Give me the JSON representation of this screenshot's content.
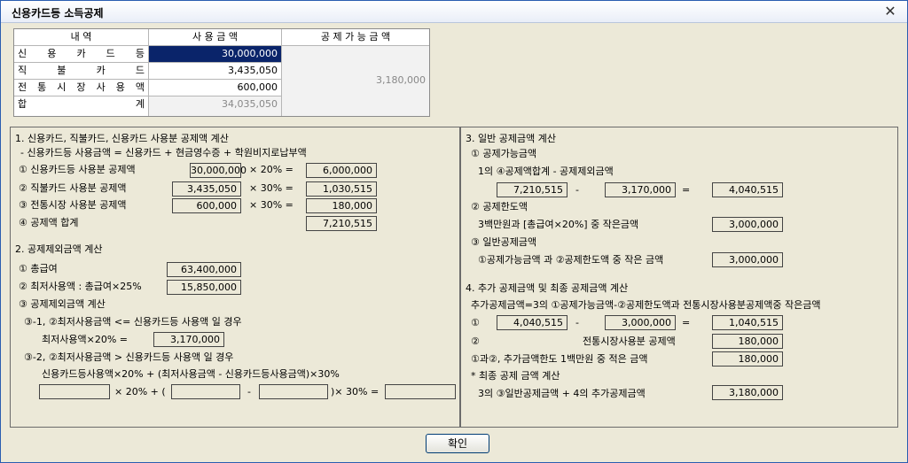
{
  "window": {
    "title": "신용카드등 소득공제"
  },
  "table": {
    "headers": {
      "item": "내 역",
      "amount": "사 용 금 액",
      "deductible": "공 제 가 능 금 액"
    },
    "rows": [
      {
        "label": "신 용 카 드 등",
        "value": "30,000,000"
      },
      {
        "label": "직 불 카 드",
        "value": "3,435,050"
      },
      {
        "label": "전 통 시 장 사 용 액",
        "value": "600,000"
      },
      {
        "label": "합 계",
        "value": "34,035,050"
      }
    ],
    "deductible_value": "3,180,000"
  },
  "left": {
    "s1_title": "1. 신용카드, 직불카드, 신용카드 사용분 공제액 계산",
    "s1_note": "- 신용카드등 사용금액 = 신용카드 + 현금영수증 + 학원비지로납부액",
    "r1_label": "① 신용카드등 사용분 공제액",
    "r1_amount": "30,000,000",
    "r1_rate": "× 20% =",
    "r1_result": "6,000,000",
    "r2_label": "② 직불카드 사용분 공제액",
    "r2_amount": "3,435,050",
    "r2_rate": "× 30% =",
    "r2_result": "1,030,515",
    "r3_label": "③ 전통시장 사용분 공제액",
    "r3_amount": "600,000",
    "r3_rate": "× 30% =",
    "r3_result": "180,000",
    "r4_label": "④ 공제액 합계",
    "r4_result": "7,210,515",
    "s2_title": "2. 공제제외금액 계산",
    "s2_r1_label": "① 총급여",
    "s2_r1_value": "63,400,000",
    "s2_r2_label": "② 최저사용액 : 총급여×25%",
    "s2_r2_value": "15,850,000",
    "s2_r3_label": "③ 공제제외금액 계산",
    "s2_c1": "③-1,  ②최저사용금액 <= 신용카드등 사용액 일 경우",
    "s2_c1_formula": "최저사용액×20% =",
    "s2_c1_value": "3,170,000",
    "s2_c2": "③-2,  ②최저사용금액 > 신용카드등 사용액 일 경우",
    "s2_c2_formula": "신용카드등사용액×20% + (최저사용금액 - 신용카드등사용금액)×30%",
    "s2_c2_t1": "× 20% + (",
    "s2_c2_t2": "-",
    "s2_c2_t3": ")× 30% ="
  },
  "right": {
    "s3_title": "3. 일반 공제금액 계산",
    "s3_a": "① 공제가능금액",
    "s3_a_formula": "1의 ④공제액합계 - 공제제외금액",
    "s3_a_v1": "7,210,515",
    "s3_a_minus": "-",
    "s3_a_v2": "3,170,000",
    "s3_a_eq": "=",
    "s3_a_v3": "4,040,515",
    "s3_b": "② 공제한도액",
    "s3_b_formula": "3백만원과 [총급여×20%] 중 작은금액",
    "s3_b_value": "3,000,000",
    "s3_c": "③ 일반공제금액",
    "s3_c_formula": "①공제가능금액  과 ②공제한도액 중 작은 금액",
    "s3_c_value": "3,000,000",
    "s4_title": "4. 추가 공제금액 및 최종 공제금액 계산",
    "s4_formula": "추가공제금액=3의 ①공제가능금액-②공제한도액과 전통시장사용분공제액중 작은금액",
    "s4_r1_mark": "①",
    "s4_r1_v1": "4,040,515",
    "s4_r1_minus": "-",
    "s4_r1_v2": "3,000,000",
    "s4_r1_eq": "=",
    "s4_r1_v3": "1,040,515",
    "s4_r2_mark": "②",
    "s4_r2_label": "전통시장사용분 공제액",
    "s4_r2_value": "180,000",
    "s4_r3_label": "①과②, 추가금액한도 1백만원 중 적은 금액",
    "s4_r3_value": "180,000",
    "s4_final_title": "* 최종 공제 금액 계산",
    "s4_final_label": "3의 ③일반공제금액 + 4의 추가공제금액",
    "s4_final_value": "3,180,000"
  },
  "buttons": {
    "confirm": "확인"
  }
}
